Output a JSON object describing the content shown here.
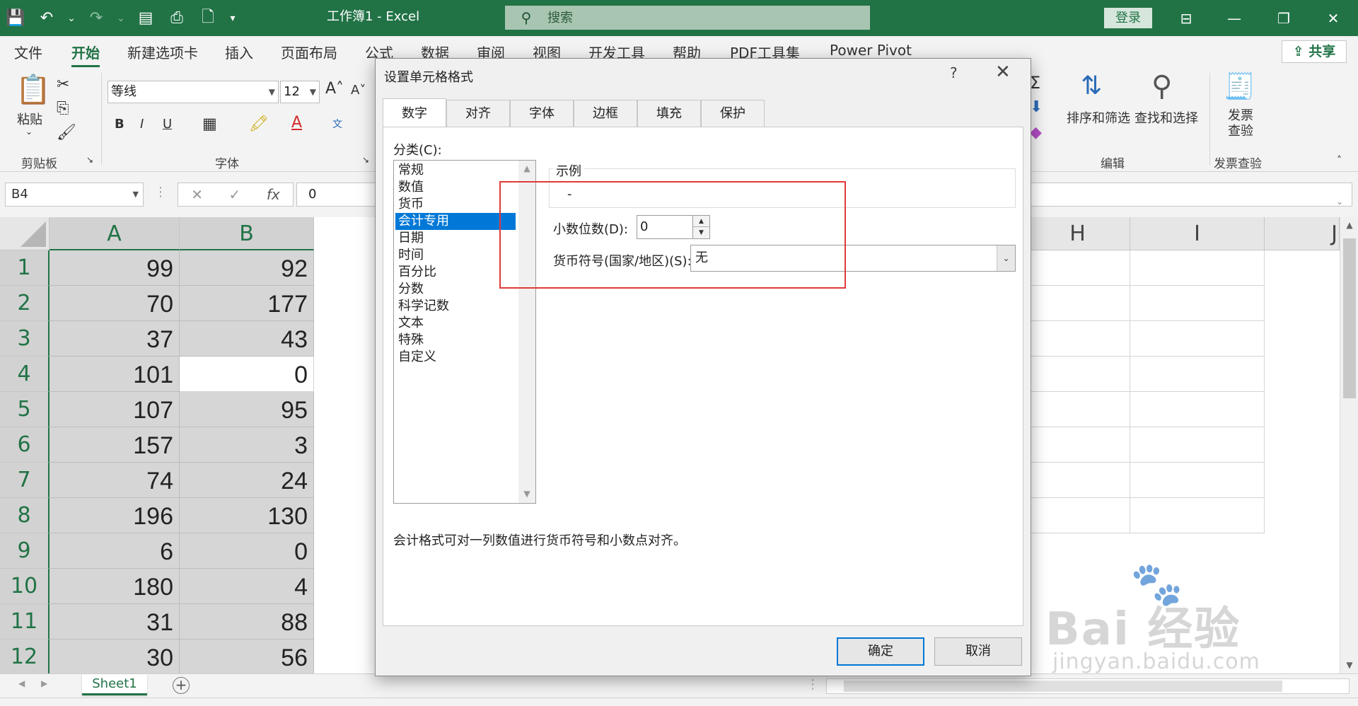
{
  "titlebar": {
    "title": "工作簿1  -  Excel",
    "search_placeholder": "搜索",
    "login": "登录"
  },
  "ribbon_tabs": [
    "文件",
    "开始",
    "新建选项卡",
    "插入",
    "页面布局",
    "公式",
    "数据",
    "审阅",
    "视图",
    "开发工具",
    "帮助",
    "PDF工具集",
    "Power Pivot"
  ],
  "share": "共享",
  "ribbon": {
    "paste": "粘贴",
    "clipboard_group": "剪贴板",
    "font_group": "字体",
    "font_name": "等线",
    "font_size": "12",
    "bold": "B",
    "italic": "I",
    "underline": "U",
    "sort_filter": "排序和筛选",
    "find_select": "查找和选择",
    "edit_group": "编辑",
    "invoice_check": "发票\n查验",
    "invoice_group": "发票查验"
  },
  "formula_bar": {
    "name_box": "B4",
    "fx": "fx",
    "value": "0"
  },
  "grid": {
    "columns": [
      "A",
      "B",
      "H",
      "I",
      "J"
    ],
    "rows": [
      "1",
      "2",
      "3",
      "4",
      "5",
      "6",
      "7",
      "8",
      "9",
      "10",
      "11",
      "12"
    ],
    "colA": [
      "99",
      "70",
      "37",
      "101",
      "107",
      "157",
      "74",
      "196",
      "6",
      "180",
      "31",
      "30"
    ],
    "colB": [
      "92",
      "177",
      "43",
      "0",
      "95",
      "3",
      "24",
      "130",
      "0",
      "4",
      "88",
      "56"
    ]
  },
  "sheet_tab": "Sheet1",
  "dialog": {
    "title": "设置单元格格式",
    "help": "?",
    "tabs": [
      "数字",
      "对齐",
      "字体",
      "边框",
      "填充",
      "保护"
    ],
    "category_label": "分类(C):",
    "categories": [
      "常规",
      "数值",
      "货币",
      "会计专用",
      "日期",
      "时间",
      "百分比",
      "分数",
      "科学记数",
      "文本",
      "特殊",
      "自定义"
    ],
    "selected_category": "会计专用",
    "sample_label": "示例",
    "sample_value": "-",
    "decimal_label": "小数位数(D):",
    "decimal_value": "0",
    "currency_label": "货币符号(国家/地区)(S):",
    "currency_value": "无",
    "description": "会计格式可对一列数值进行货币符号和小数点对齐。",
    "ok": "确定",
    "cancel": "取消"
  },
  "watermark": {
    "brand": "Bai 经验",
    "url": "jingyan.baidu.com"
  },
  "colors": {
    "excel_green": "#217346",
    "selection_gray": "#d6d6d6",
    "dialog_blue": "#0078d7",
    "highlight_red": "#e03a3a"
  }
}
